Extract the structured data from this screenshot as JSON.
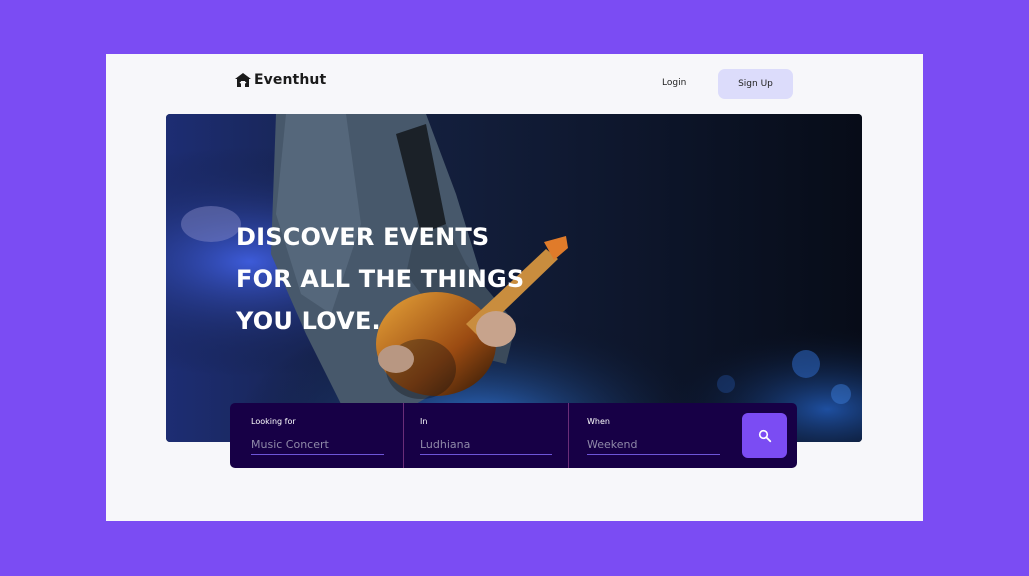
{
  "header": {
    "brand": "Eventhut",
    "login_label": "Login",
    "signup_label": "Sign Up"
  },
  "hero": {
    "title_lines": [
      "DISCOVER EVENTS",
      "FOR ALL THE THINGS",
      "YOU LOVE."
    ]
  },
  "search": {
    "looking_for": {
      "label": "Looking for",
      "placeholder": "Music Concert"
    },
    "location": {
      "label": "In",
      "placeholder": "Ludhiana"
    },
    "when": {
      "label": "When",
      "placeholder": "Weekend"
    },
    "button_icon": "search-icon"
  },
  "colors": {
    "background": "#7b4cf3",
    "accent": "#7b4cf3",
    "search_bar": "#170046",
    "signup_bg": "#dcdcfb"
  }
}
